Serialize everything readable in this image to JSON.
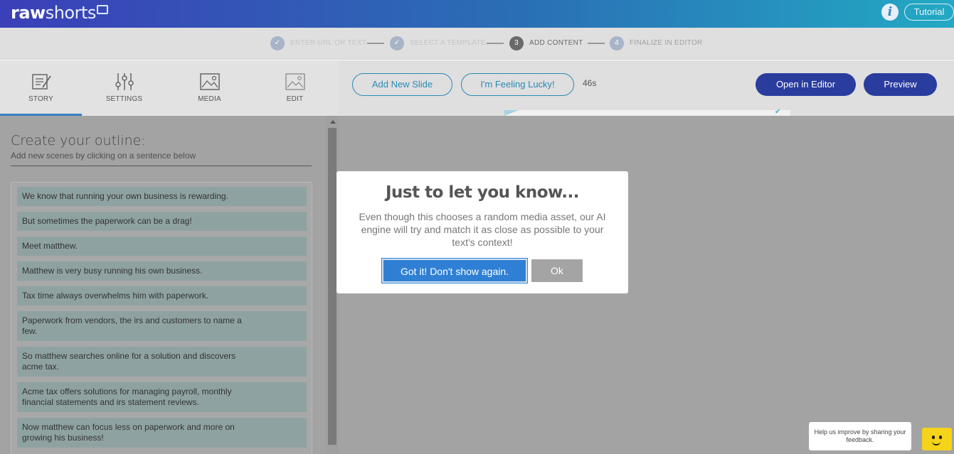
{
  "header": {
    "logo_bold": "raw",
    "logo_light": "shorts",
    "tutorial_label": "Tutorial"
  },
  "steps": [
    {
      "number": "✓",
      "label": "ENTER URL OR TEXT",
      "state": "done"
    },
    {
      "number": "✓",
      "label": "SELECT A TEMPLATE",
      "state": "done"
    },
    {
      "number": "3",
      "label": "ADD CONTENT",
      "state": "active"
    },
    {
      "number": "4",
      "label": "FINALIZE IN EDITOR",
      "state": "future"
    }
  ],
  "tabs": [
    {
      "label": "STORY",
      "icon": "story-icon",
      "active": true
    },
    {
      "label": "SETTINGS",
      "icon": "sliders-icon",
      "active": false
    },
    {
      "label": "MEDIA",
      "icon": "image-icon",
      "active": false
    },
    {
      "label": "EDIT",
      "icon": "edit-image-icon",
      "active": false
    }
  ],
  "outline": {
    "title": "Create your outline:",
    "subtitle": "Add new scenes by clicking on a sentence below",
    "sentences": [
      "We know that running your own business is rewarding.",
      "But sometimes the paperwork can be a drag!",
      "Meet matthew.",
      "Matthew is very busy running his own business.",
      "Tax time always overwhelms him with paperwork.",
      "Paperwork from vendors, the irs and customers to name a few.",
      "So matthew searches online for a solution and discovers acme tax.",
      "Acme tax offers solutions for managing payroll, monthly financial statements and irs statement reviews.",
      "Now matthew can focus less on paperwork and more on growing his business!"
    ]
  },
  "toolbar": {
    "add_slide": "Add New Slide",
    "feeling_lucky": "I'm Feeling Lucky!",
    "duration": "46s",
    "open_editor": "Open in Editor",
    "preview": "Preview"
  },
  "modal": {
    "title": "Just to let you know...",
    "body": "Even though this chooses a random media asset, our AI engine will try and match it as close as possible to your text's context!",
    "got_it": "Got it! Don't show again.",
    "ok": "Ok"
  },
  "feedback": {
    "text": "Help us improve by sharing your feedback."
  },
  "colors": {
    "accent": "#2a8bb6",
    "primary_button": "#2a3c9e",
    "modal_button": "#2f80d4"
  }
}
